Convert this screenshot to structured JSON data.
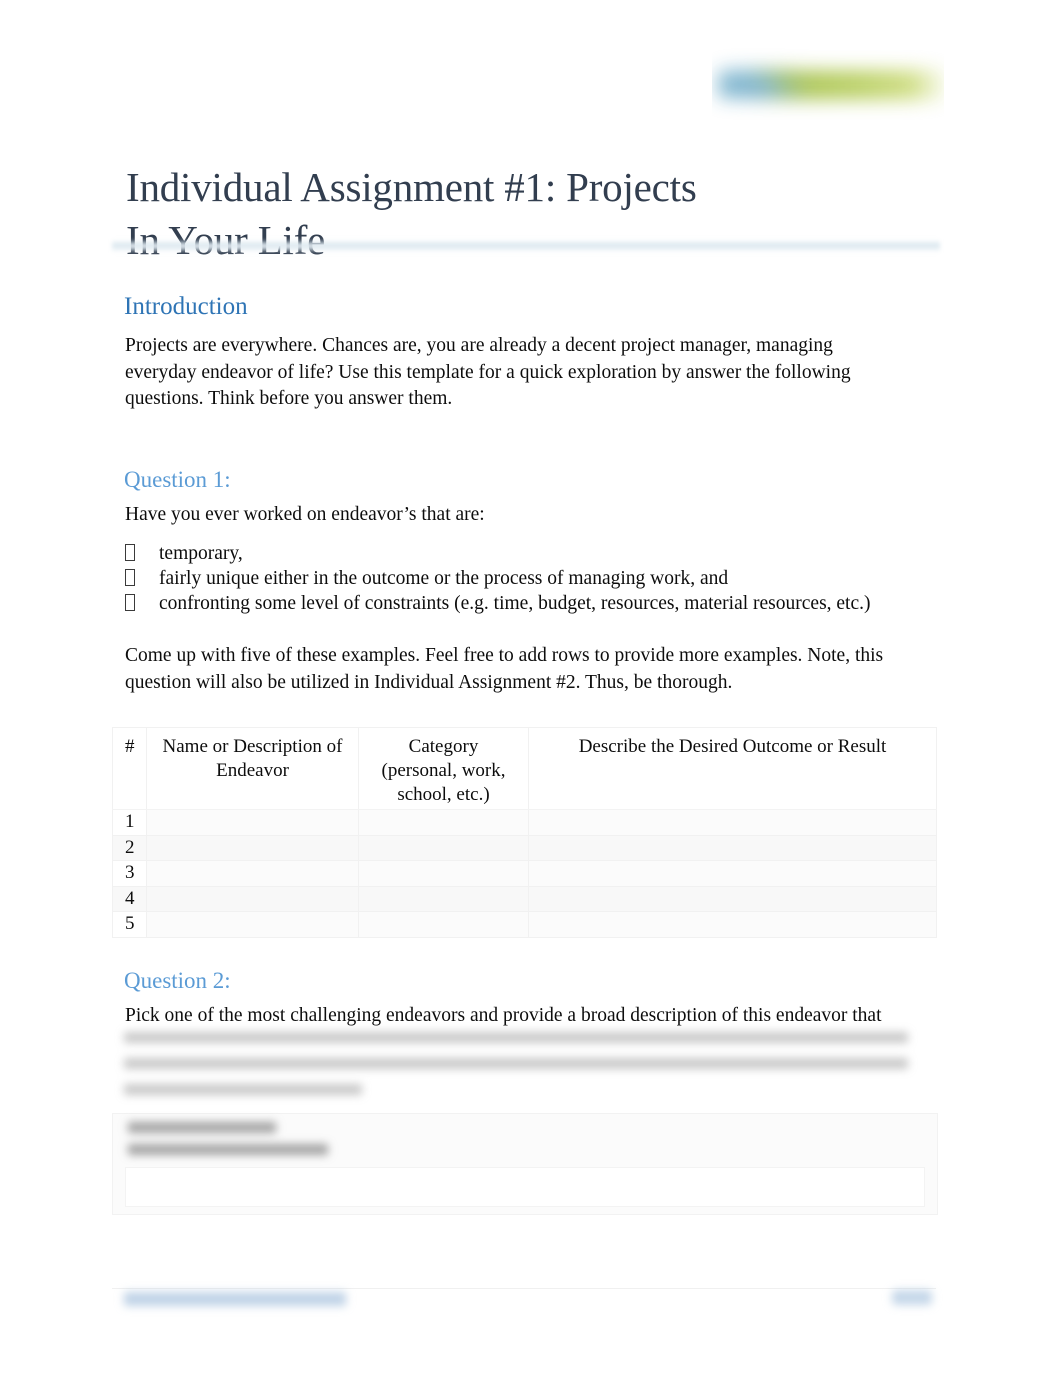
{
  "document": {
    "title_line1": "Individual Assignment #1: Projects",
    "title_line2": "In Your Life",
    "logo": "company-logo-redacted"
  },
  "introduction": {
    "heading": "Introduction",
    "paragraph": "Projects are everywhere.   Chances are, you are already a decent project manager, managing everyday endeavor of life?  Use this template for a quick exploration by answer the following questions. Think before you answer them."
  },
  "question1": {
    "heading": "Question 1:",
    "prompt": "Have you ever worked on endeavor’s that are:",
    "bullet_glyph": "missing-glyph-box",
    "bullets": [
      "temporary,",
      "fairly unique either in the outcome or the process of managing work, and",
      "confronting some level of constraints (e.g. time, budget, resources, material resources, etc.)"
    ],
    "instruction": "Come up with five of these examples. Feel free to add rows to provide more examples. Note, this question will also be utilized in Individual Assignment #2. Thus, be thorough.",
    "table": {
      "headers": [
        "#",
        "Name or Description of Endeavor",
        "Category (personal, work, school, etc.)",
        "Describe the Desired Outcome or Result"
      ],
      "header_lines": {
        "col1": [
          "#"
        ],
        "col2": [
          "Name or Description of",
          "Endeavor"
        ],
        "col3": [
          "Category",
          "(personal, work,",
          "school, etc.)"
        ],
        "col4": [
          "Describe the Desired Outcome or Result"
        ]
      },
      "rows": [
        {
          "num": "1",
          "name": "",
          "category": "",
          "outcome": ""
        },
        {
          "num": "2",
          "name": "",
          "category": "",
          "outcome": ""
        },
        {
          "num": "3",
          "name": "",
          "category": "",
          "outcome": ""
        },
        {
          "num": "4",
          "name": "",
          "category": "",
          "outcome": ""
        },
        {
          "num": "5",
          "name": "",
          "category": "",
          "outcome": ""
        }
      ]
    }
  },
  "question2": {
    "heading": "Question 2:",
    "prompt": "Pick one of the most challenging endeavors and provide a broad description of this endeavor that",
    "prompt_continuation": "blurred-redacted-text",
    "answer_box": "blurred-redacted-answer-table"
  },
  "footer": {
    "left": "blurred-redacted-footer-text",
    "right": "blurred-redacted-page-number"
  },
  "colors": {
    "title": "#323e4f",
    "heading1": "#2e74b5",
    "heading2": "#5b9bd5",
    "body_text": "#0d0d0d",
    "rule": "#dde9f0",
    "table_border": "#f1f1f1",
    "page_background": "#ffffff"
  }
}
